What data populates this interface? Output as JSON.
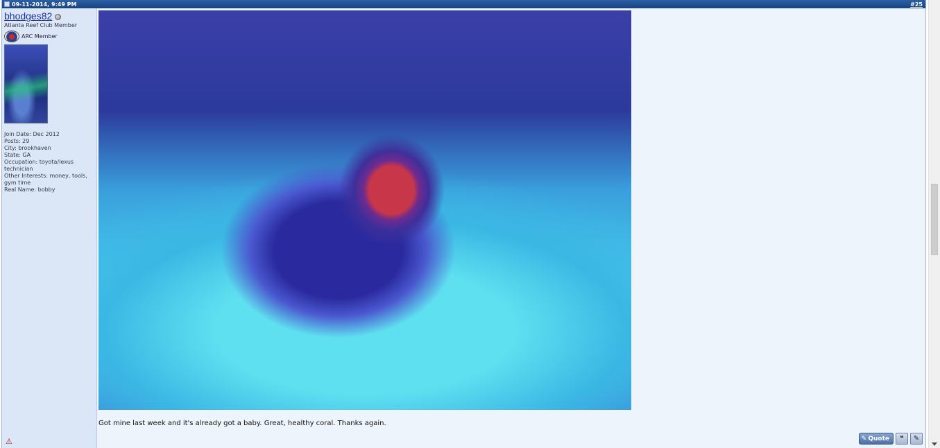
{
  "post": {
    "date": "09-11-2014, 9:49 PM",
    "number": "#25",
    "text": "Got mine last week and it's already got a baby. Great, healthy coral. Thanks again."
  },
  "user": {
    "username": "bhodges82",
    "title": "Atlanta Reef Club Member",
    "rank": "ARC Member",
    "info": [
      "Join Date: Dec 2012",
      "Posts: 29",
      "City: brookhaven",
      "State: GA",
      "Occupation: toyota/lexus technician",
      "Other Interests: money, tools, gym time",
      "Real Name: bobby"
    ]
  },
  "buttons": {
    "quote_label": "Quote"
  },
  "icons": {
    "status": "offline-status-icon",
    "report": "report-warning-icon",
    "multiquote": "multiquote-icon",
    "quick_reply": "quick-reply-icon"
  }
}
